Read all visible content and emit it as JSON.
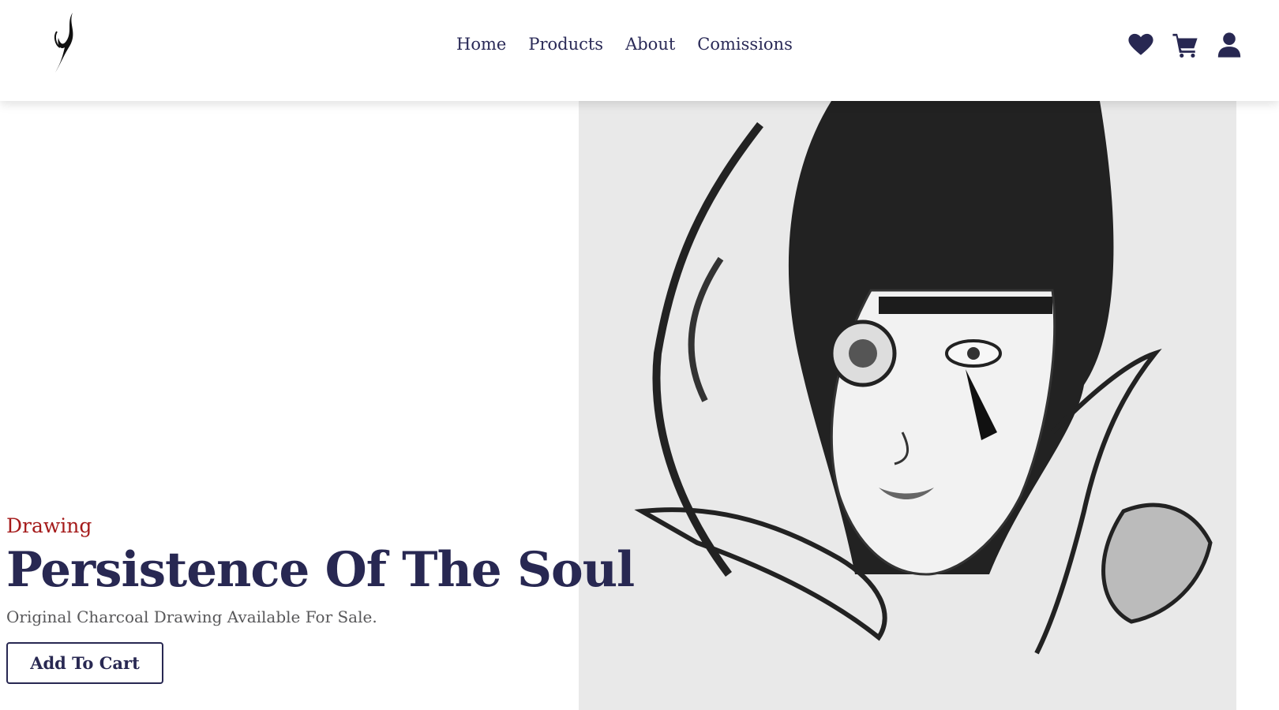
{
  "nav": {
    "items": [
      "Home",
      "Products",
      "About",
      "Comissions"
    ]
  },
  "icons": [
    "heart-icon",
    "cart-icon",
    "user-icon"
  ],
  "hero": {
    "category": "Drawing",
    "title": "Persistence Of The Soul",
    "subtitle": "Original Charcoal Drawing Available For Sale.",
    "button_label": "Add To Cart"
  },
  "colors": {
    "brand": "#282852",
    "accent_red": "#a51b1b",
    "text_muted": "#58585a"
  }
}
